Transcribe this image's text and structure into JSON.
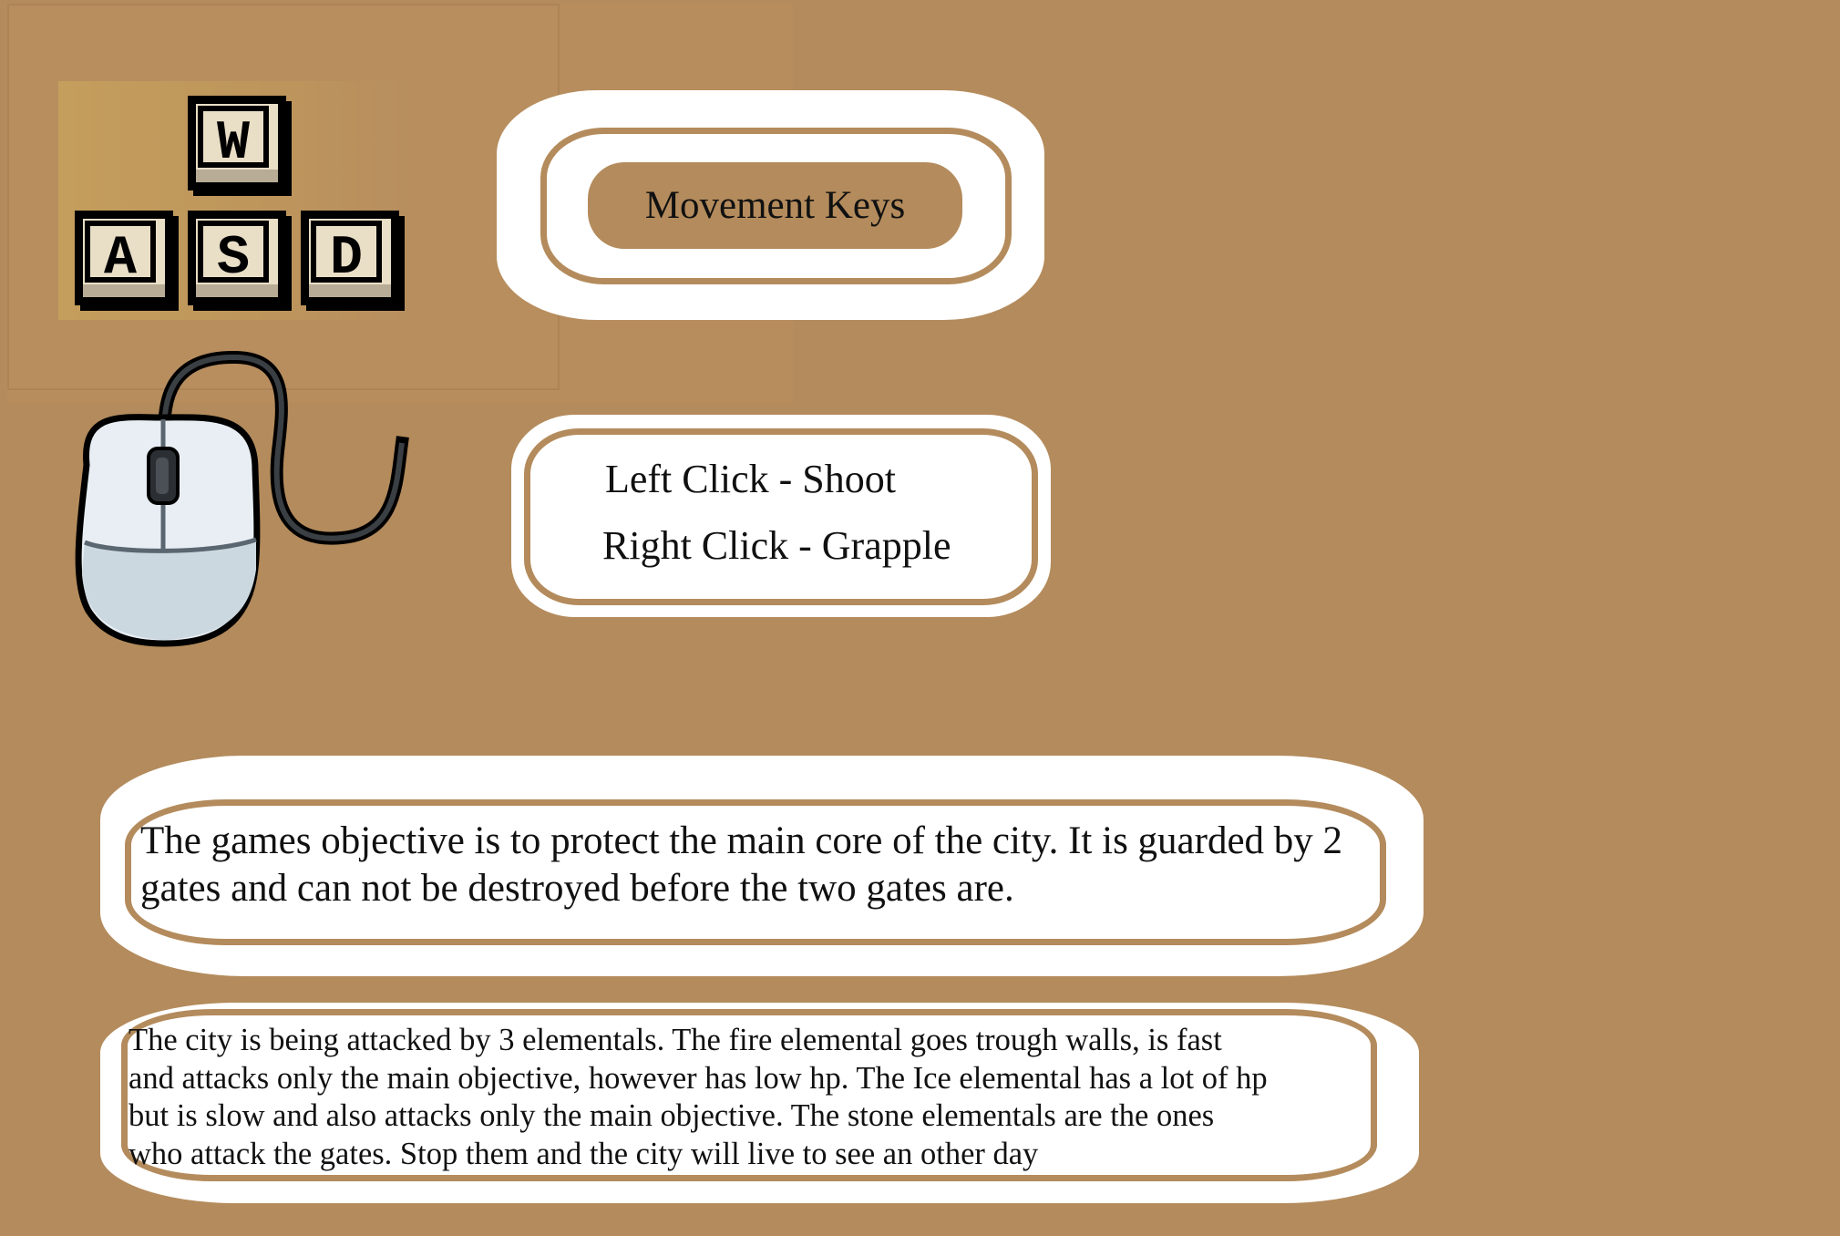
{
  "controls": {
    "keys": [
      "W",
      "A",
      "S",
      "D"
    ],
    "movement_label": "Movement Keys",
    "left_click": "Left Click - Shoot",
    "right_click": "Right Click - Grapple"
  },
  "objective": {
    "text": "The games objective is to protect the main core of the city. It is guarded by 2 gates and can not be destroyed before the two gates are."
  },
  "story": {
    "lines": [
      "The city is being attacked by 3 elementals.  The fire elemental goes trough walls, is fast",
      "and attacks only the main objective, however has low hp. The Ice elemental has a lot of hp",
      "but is slow and also attacks only the main objective. The stone elementals are the ones",
      "who attack the gates. Stop them and the city will live to see an other day"
    ]
  },
  "colors": {
    "background": "#b48b5c",
    "panel": "#ffffff",
    "text": "#111111",
    "key_outline": "#000000",
    "mouse_body": "#e8eef3"
  },
  "icons": [
    "wasd-keys-icon",
    "mouse-icon"
  ]
}
